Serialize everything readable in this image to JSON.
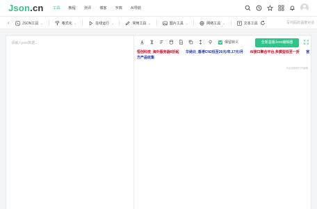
{
  "header": {
    "logo_main": "Json",
    "logo_tld": ".cn",
    "nav": [
      "工具",
      "教程",
      "测评",
      "博客",
      "字典",
      "AI导航"
    ],
    "icons": [
      "search-icon",
      "history-icon",
      "star-icon",
      "apps-icon",
      "notification-icon",
      "avatar"
    ]
  },
  "toolbar": {
    "items": [
      {
        "icon": "json-icon",
        "label": "JSON工具"
      },
      {
        "icon": "brush-icon",
        "label": "格式化"
      },
      {
        "icon": "play-icon",
        "label": "在线运行"
      },
      {
        "icon": "pen-icon",
        "label": "常用工具"
      },
      {
        "icon": "image-icon",
        "label": "图片工具"
      },
      {
        "icon": "globe-icon",
        "label": "网络工具"
      },
      {
        "icon": "text-icon",
        "label": "文本工具"
      }
    ],
    "search_placeholder": "写代码的温度对话"
  },
  "editor": {
    "input_placeholder": "请输入json数据...",
    "keep_escape_label": "保留转义",
    "new_button_label": "全新基版Json编辑器",
    "ads": [
      {
        "text": "恒创科技_海外服务器8折起",
        "color": "#d0021b"
      },
      {
        "text": "华纳云_香港CN2低至26元/年,17元/月",
        "color": "#1a35b8"
      },
      {
        "text": "AI接口聚合平台,多模型低至一折",
        "color": "#d0021b"
      },
      {
        "text": "官方产品收集",
        "color": "#1a35b8"
      }
    ],
    "ad_note": "可点击跳转打开编辑"
  }
}
